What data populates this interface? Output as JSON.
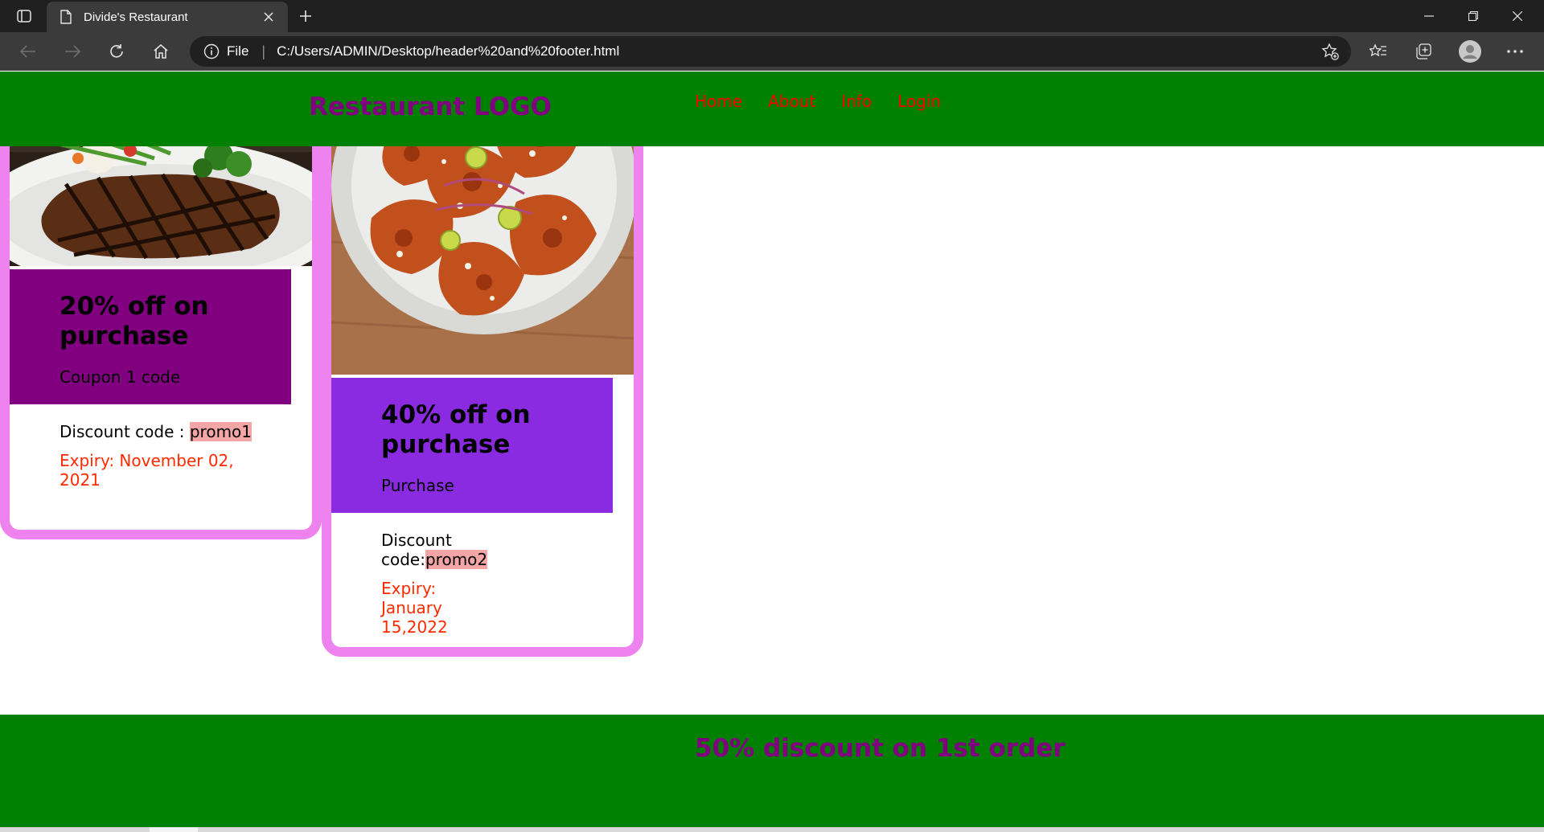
{
  "browser": {
    "tab_title": "Divide's Restaurant",
    "address_scheme": "File",
    "address_url": "C:/Users/ADMIN/Desktop/header%20and%20footer.html",
    "icons": {
      "tab_actions": "tab-actions-icon",
      "page": "page-icon",
      "close": "close-icon",
      "new_tab": "plus-icon",
      "back": "back-arrow-icon",
      "forward": "forward-arrow-icon",
      "refresh": "refresh-icon",
      "home": "home-icon",
      "info": "info-icon",
      "add_favorite": "add-favorite-icon",
      "favorites": "favorites-icon",
      "collections": "collections-icon",
      "profile": "profile-avatar-icon",
      "more": "more-icon"
    }
  },
  "header": {
    "logo": "Restaurant LOGO",
    "nav": [
      "Home",
      "About",
      "Info",
      "Login"
    ]
  },
  "coupons": [
    {
      "image": "steak-dish-image",
      "title": "20% off on purchase",
      "subtitle": "Coupon 1 code",
      "code_label": "Discount code : ",
      "code": "promo1",
      "expiry": "Expiry: November 02, 2021"
    },
    {
      "image": "tandoori-chicken-image",
      "title": "40% off on purchase",
      "subtitle": "Purchase",
      "code_label": "Discount code:",
      "code": "promo2",
      "expiry": "Expiry: January 15,2022"
    }
  ],
  "footer": {
    "text": "50% discount on 1st order"
  },
  "colors": {
    "header_bg": "#008000",
    "logo": "#800080",
    "nav_link": "#ff0000",
    "card_border": "#ee82ee",
    "coupon1_bg": "#800080",
    "coupon2_bg": "#8a2be2",
    "promo_highlight": "#f4a6a6",
    "expiry": "#ff2a00"
  }
}
